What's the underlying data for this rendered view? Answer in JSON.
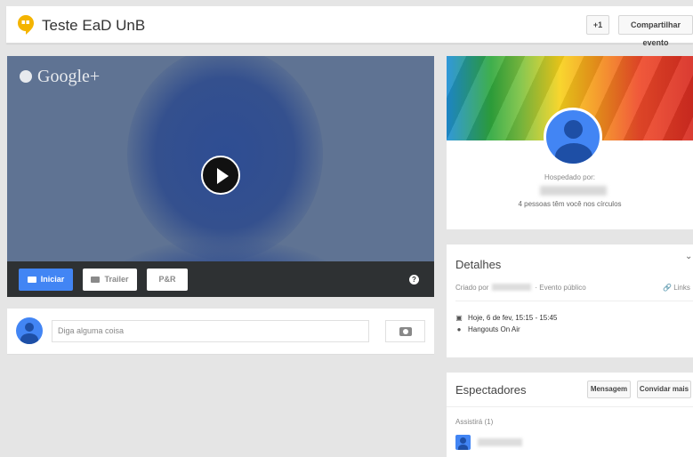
{
  "header": {
    "title": "Teste EaD UnB",
    "plus_one_label": "+1",
    "share_label": "Compartilhar evento",
    "brand_color": "#f4b400"
  },
  "video": {
    "watermark": "Google+",
    "controls": {
      "start_label": "Iniciar",
      "trailer_label": "Trailer",
      "qa_label": "P&R",
      "help_label": "?"
    }
  },
  "comment": {
    "placeholder": "Diga alguma coisa"
  },
  "host": {
    "hosted_by_label": "Hospedado por:",
    "circles_text": "4 pessoas têm você nos círculos"
  },
  "details": {
    "title": "Detalhes",
    "created_by_label": "Criado por",
    "visibility": "· Evento público",
    "links_label": "Links",
    "date_text": "Hoje, 6 de fev, 15:15 - 15:45",
    "location_text": "Hangouts On Air"
  },
  "viewers": {
    "title": "Espectadores",
    "message_label": "Mensagem",
    "invite_label": "Convidar mais",
    "attending_label": "Assistirá (1)"
  },
  "colors": {
    "accent": "#4285f4",
    "control_bar": "#2e3133"
  },
  "icons": {
    "hangouts": "hangouts-icon",
    "play": "play-icon",
    "camera": "camera-icon",
    "calendar": "calendar-icon",
    "location": "location-pin-icon",
    "link": "link-icon",
    "chevron": "chevron-down-icon",
    "help": "help-icon"
  }
}
